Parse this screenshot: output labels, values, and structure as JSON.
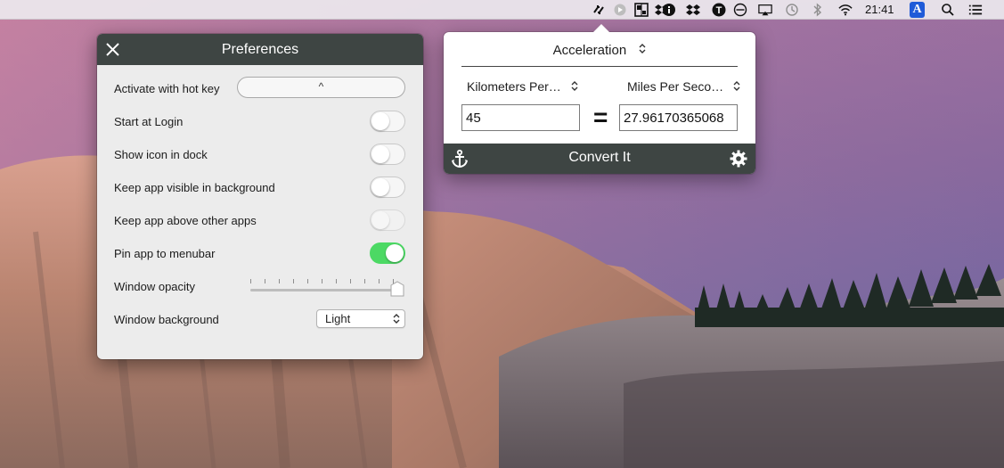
{
  "menubar": {
    "clock": "21:41",
    "icons": [
      "converter-arrows-icon",
      "record-icon",
      "grid-app-icon",
      "dropbox-icon",
      "info-circle-icon",
      "typeit-icon",
      "airplay-icon",
      "time-machine-icon",
      "bluetooth-icon",
      "wifi-icon",
      "input-source-icon",
      "spotlight-icon",
      "notification-center-icon"
    ],
    "input_source_letter": "A",
    "typeit_letter": "T"
  },
  "preferences": {
    "title": "Preferences",
    "rows": [
      {
        "label": "Activate with hot key",
        "control": "hotkey",
        "value": "^"
      },
      {
        "label": "Start at Login",
        "control": "toggle",
        "on": false
      },
      {
        "label": "Show icon in dock",
        "control": "toggle",
        "on": false
      },
      {
        "label": "Keep app visible in background",
        "control": "toggle",
        "on": false
      },
      {
        "label": "Keep app above other apps",
        "control": "toggle",
        "on": false,
        "disabled": true
      },
      {
        "label": "Pin app to menubar",
        "control": "toggle",
        "on": true
      },
      {
        "label": "Window opacity",
        "control": "slider",
        "value": 1.0
      },
      {
        "label": "Window background",
        "control": "select",
        "value": "Light"
      }
    ]
  },
  "converter": {
    "category": "Acceleration",
    "from_unit": "Kilometers Per…",
    "to_unit": "Miles Per Seco…",
    "from_value": "45",
    "to_value": "27.96170365068",
    "equals": "=",
    "convert_label": "Convert It"
  },
  "colors": {
    "header_dark": "#3e4543",
    "toggle_on": "#4cd964",
    "menubar_bg": "#ece8ee"
  }
}
